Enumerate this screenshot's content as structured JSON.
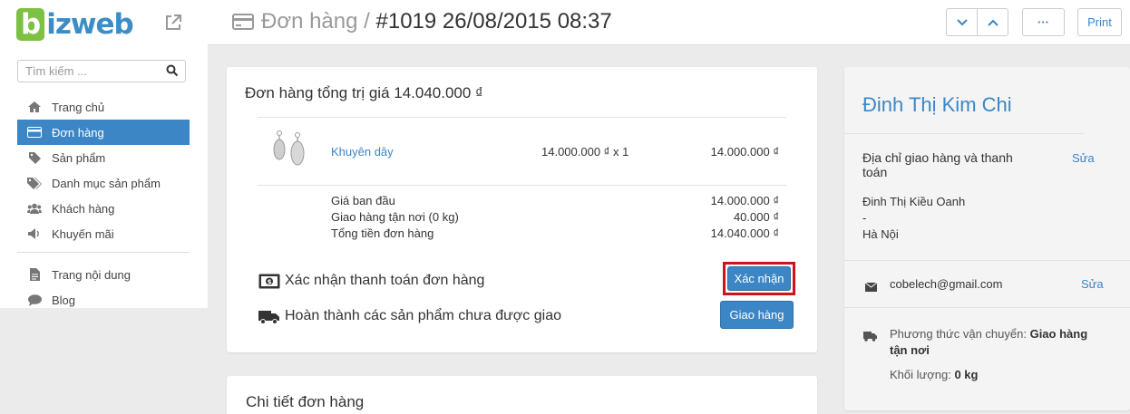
{
  "app": {
    "logo_b": "b",
    "logo_iz": "iz",
    "logo_web": "web"
  },
  "search": {
    "placeholder": "Tìm kiếm ..."
  },
  "sidebar": {
    "items": [
      {
        "label": "Trang chủ",
        "icon": "home-icon"
      },
      {
        "label": "Đơn hàng",
        "icon": "credit-card-icon",
        "active": true
      },
      {
        "label": "Sản phẩm",
        "icon": "tag-icon"
      },
      {
        "label": "Danh mục sản phẩm",
        "icon": "tags-icon"
      },
      {
        "label": "Khách hàng",
        "icon": "users-icon"
      },
      {
        "label": "Khuyến mãi",
        "icon": "megaphone-icon"
      },
      {
        "label": "Trang nội dung",
        "icon": "file-icon"
      },
      {
        "label": "Blog",
        "icon": "comment-icon"
      }
    ]
  },
  "header": {
    "section": "Đơn hàng",
    "separator": " / ",
    "order_title": "#1019 26/08/2015 08:37",
    "more_label": "···",
    "print_label": "Print"
  },
  "order": {
    "title": "Đơn hàng tổng trị giá 14.040.000 ₫",
    "item": {
      "name": "Khuyên dây",
      "price_qty": "14.000.000 ₫ x 1",
      "total": "14.000.000 ₫"
    },
    "summary": [
      {
        "label": "Giá ban đầu",
        "value": "14.000.000 ₫"
      },
      {
        "label": "Giao hàng tận nơi (0 kg)",
        "value": "40.000 ₫"
      },
      {
        "label": "Tổng tiền đơn hàng",
        "value": "14.040.000 ₫"
      }
    ],
    "payment_text": "Xác nhận thanh toán đơn hàng",
    "confirm_label": "Xác nhận",
    "fulfill_text": "Hoàn thành các sản phẩm chưa được giao",
    "ship_label": "Giao hàng"
  },
  "details": {
    "title": "Chi tiết đơn hàng"
  },
  "customer": {
    "name": "Đinh Thị Kim Chi",
    "address_heading_1": "Địa chỉ giao hàng và thanh",
    "address_heading_2": "toán",
    "edit_label": "Sửa",
    "address_name": "Đinh Thị Kiều Oanh",
    "address_dash": "-",
    "address_city": "Hà Nội",
    "email": "cobelech@gmail.com",
    "shipping_label": "Phương thức vận chuyển: ",
    "shipping_value_1": "Giao hàng",
    "shipping_value_2": "tận nơi",
    "weight_label": "Khối lượng: ",
    "weight_value": "0 kg"
  },
  "colors": {
    "accent": "#3c86c6",
    "logo_green": "#7cc142",
    "highlight": "#d0101a"
  }
}
